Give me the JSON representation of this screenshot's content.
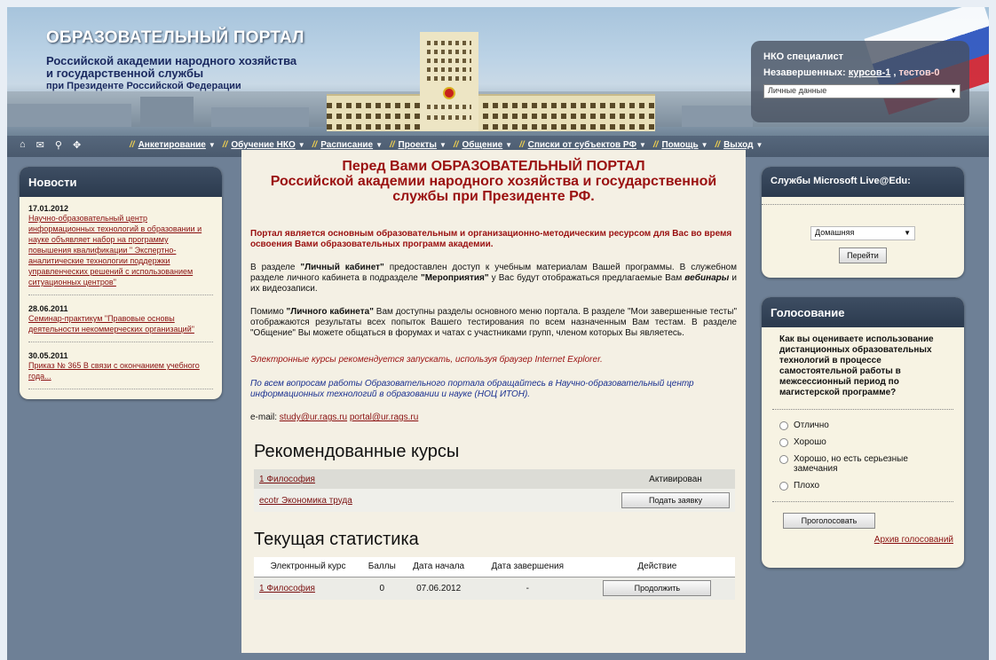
{
  "header": {
    "title": "ОБРАЗОВАТЕЛЬНЫЙ ПОРТАЛ",
    "subtitle_line1": "Российской академии народного хозяйства",
    "subtitle_line2": "и государственной службы",
    "subtitle_line3": "при Президенте Российской Федерации"
  },
  "user_panel": {
    "name": "НКО специалист",
    "unfinished_label": "Незавершенных:",
    "courses_link": "курсов-1",
    "separator": ",",
    "tests_link": "тестов-0",
    "select_value": "Личные данные"
  },
  "menu": {
    "icons": [
      "home-icon",
      "mail-icon",
      "search-icon",
      "settings-icon"
    ],
    "items": [
      {
        "label": "Анкетирование"
      },
      {
        "label": "Обучение НКО"
      },
      {
        "label": "Расписание"
      },
      {
        "label": "Проекты"
      },
      {
        "label": "Общение"
      },
      {
        "label": "Списки от субъектов РФ"
      },
      {
        "label": "Помощь"
      },
      {
        "label": "Выход"
      }
    ]
  },
  "news": {
    "title": "Новости",
    "items": [
      {
        "date": "17.01.2012",
        "text": "Научно-образовательный центр информационных технологий в образовании и науке объявляет набор на программу повышения квалификации \" Экспертно-аналитические технологии поддержки управленческих решений с использованием ситуационных центров\""
      },
      {
        "date": "28.06.2011",
        "text": "Семинар-практикум \"Правовые основы деятельности некоммерческих организаций\""
      },
      {
        "date": "30.05.2011",
        "text": "Приказ № 365 В связи с окончанием учебного года..."
      }
    ]
  },
  "main": {
    "heading_line1": "Перед Вами ОБРАЗОВАТЕЛЬНЫЙ ПОРТАЛ",
    "heading_line2": "Российской академии народного хозяйства и государственной",
    "heading_line3": "службы при Президенте РФ.",
    "intro": "Портал является основным образовательным и организационно-методическим ресурсом для Вас во время освоения Вами образовательных программ академии.",
    "p1_a": "В разделе ",
    "p1_b": "\"Личный кабинет\"",
    "p1_c": " предоставлен доступ к учебным материалам Вашей программы. В служебном разделе личного кабинета в подразделе ",
    "p1_d": "\"Мероприятия\"",
    "p1_e": " у Вас будут отображаться предлагаемые Вам ",
    "p1_f": "вебинары",
    "p1_g": " и их видеозаписи.",
    "p2_a": "Помимо ",
    "p2_b": "\"Личного кабинета\"",
    "p2_c": " Вам доступны разделы основного меню портала. В разделе \"Мои завершенные тесты\" отображаются результаты всех попыток Вашего тестирования по всем назначенным Вам тестам. В разделе \"Общение\" Вы можете общаться в форумах и чатах с участниками групп, членом которых Вы являетесь.",
    "browser_note": "Электронные курсы рекомендуется запускать, используя браузер Internet Explorer.",
    "support_note": "По всем вопросам работы Образовательного портала обращайтесь в Научно-образовательный центр информационных технологий в образовании и науке (НОЦ ИТОН).",
    "email_label": "e-mail: ",
    "email1": "study@ur.rags.ru",
    "email2": "portal@ur.rags.ru"
  },
  "recommended": {
    "title": "Рекомендованные курсы",
    "rows": [
      {
        "name": "1 Философия",
        "status": "Активирован",
        "action": ""
      },
      {
        "name": "ecotr Экономика труда",
        "status": "",
        "action": "Подать заявку"
      }
    ]
  },
  "stats": {
    "title": "Текущая статистика",
    "headers": [
      "Электронный курс",
      "Баллы",
      "Дата начала",
      "Дата завершения",
      "Действие"
    ],
    "rows": [
      {
        "course": "1 Философия",
        "score": "0",
        "start": "07.06.2012",
        "end": "-",
        "action": "Продолжить"
      }
    ]
  },
  "ms_live": {
    "title": "Службы Microsoft Live@Edu:",
    "select_value": "Домашняя",
    "go_button": "Перейти"
  },
  "vote": {
    "title": "Голосование",
    "question": "Как вы оцениваете использование дистанционных образовательных технологий в процессе самостоятельной работы в межсессионный период по магистерской программе?",
    "options": [
      "Отлично",
      "Хорошо",
      "Хорошо, но есть серьезные замечания",
      "Плохо"
    ],
    "submit": "Проголосовать",
    "archive": "Архив голосований"
  }
}
